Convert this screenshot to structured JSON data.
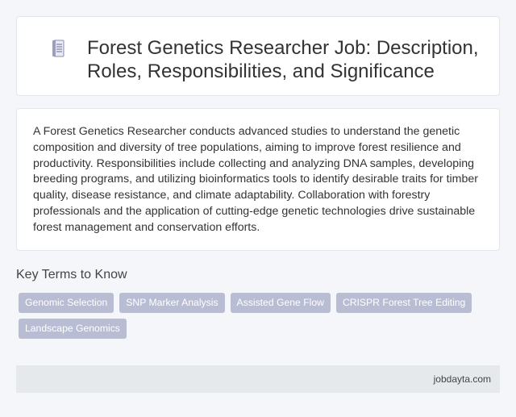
{
  "header": {
    "icon": "document-icon",
    "title": "Forest Genetics Researcher Job: Description, Roles, Responsibilities, and Significance"
  },
  "description": "A Forest Genetics Researcher conducts advanced studies to understand the genetic composition and diversity of tree populations, aiming to improve forest resilience and productivity. Responsibilities include collecting and analyzing DNA samples, developing breeding programs, and utilizing bioinformatics tools to identify desirable traits for timber quality, disease resistance, and climate adaptability. Collaboration with forestry professionals and the application of cutting-edge genetic technologies drive sustainable forest management and conservation efforts.",
  "key_terms": {
    "heading": "Key Terms to Know",
    "tags": [
      "Genomic Selection",
      "SNP Marker Analysis",
      "Assisted Gene Flow",
      "CRISPR Forest Tree Editing",
      "Landscape Genomics"
    ]
  },
  "footer": {
    "site": "jobdayta.com"
  },
  "colors": {
    "tag_background": "#b9bdd3",
    "footer_background": "#e5e9ec",
    "page_background": "#f5f6fa"
  }
}
